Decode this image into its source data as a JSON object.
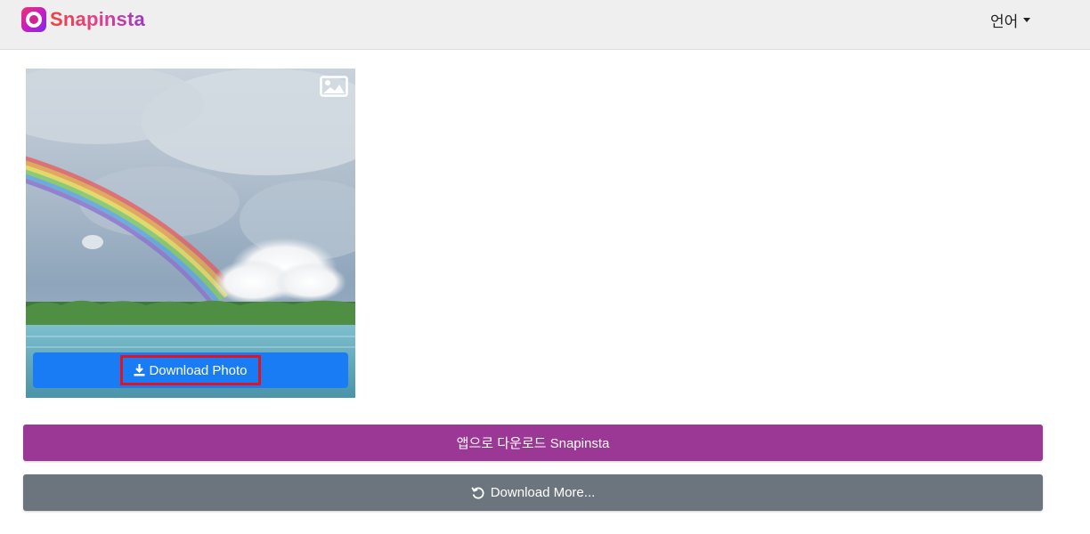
{
  "navbar": {
    "brand_name": "Snapinsta",
    "brand_icon": "instagram-camera-icon",
    "language_label": "언어",
    "language_icon": "caret-down-icon"
  },
  "photo": {
    "description_icon": "image-icon",
    "download_label": "Download Photo",
    "download_icon": "download-icon"
  },
  "actions": {
    "app_download_label": "앱으로 다운로드 Snapinsta",
    "download_more_label": "Download More...",
    "download_more_icon": "refresh-icon"
  },
  "colors": {
    "navbar_bg": "#efefef",
    "download_button": "#1a7cf5",
    "highlight_border": "#e3131e",
    "app_button": "#9b3794",
    "more_button": "#6c757d"
  }
}
